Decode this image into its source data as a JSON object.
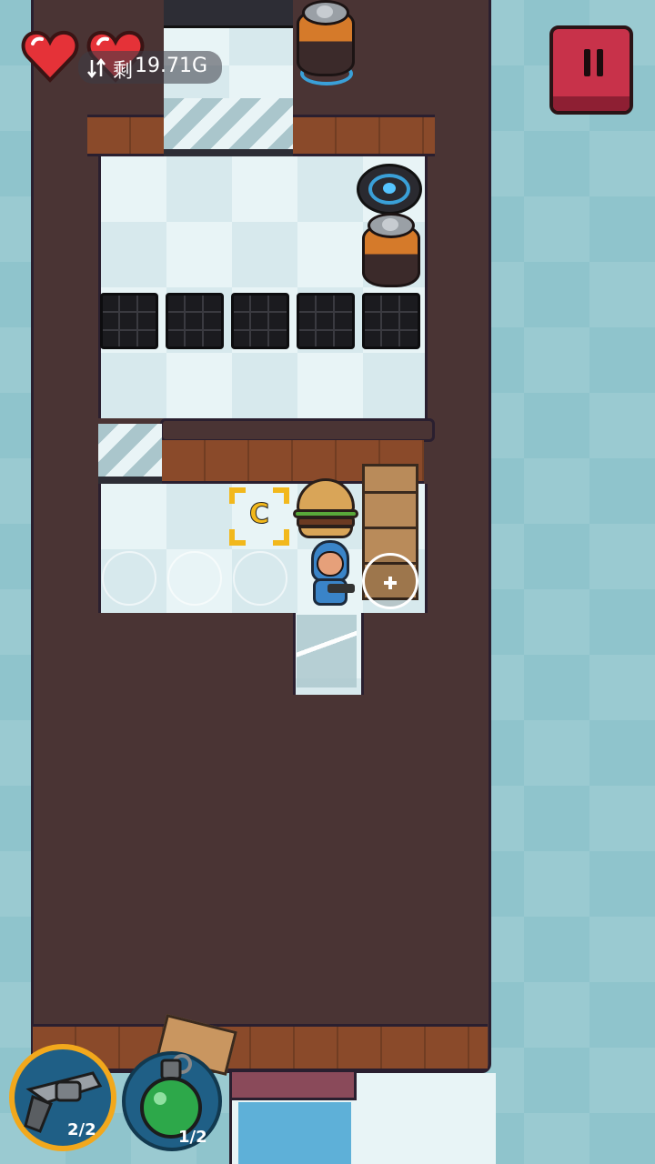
{
  "hud": {
    "hearts": 2,
    "remaining_prefix": "剩",
    "remaining_value": "19.71G",
    "remaining_icon": "swap-arrows-icon",
    "pause_icon": "pause-icon"
  },
  "colors": {
    "pause_button": "#c8324a",
    "heart": "#e53238",
    "wall": "#4a3434",
    "brick": "#8a4a2a",
    "water": "#8fc4cc",
    "target_marker": "#f2b81c"
  },
  "world": {
    "target_marker_letter": "C",
    "objects": [
      "battery-icon",
      "teleporter-pad-icon",
      "floor-grate-icon",
      "wooden-crate-icon",
      "burger-icon",
      "player-character",
      "interact-plus-icon"
    ]
  },
  "inventory": {
    "slots": [
      {
        "name": "revolver",
        "icon": "revolver-icon",
        "count": "2/2",
        "ring_color": "#f2a81c"
      },
      {
        "name": "grenade",
        "icon": "grenade-icon",
        "count": "1/2",
        "ring_color": "#1f5f86"
      }
    ]
  }
}
